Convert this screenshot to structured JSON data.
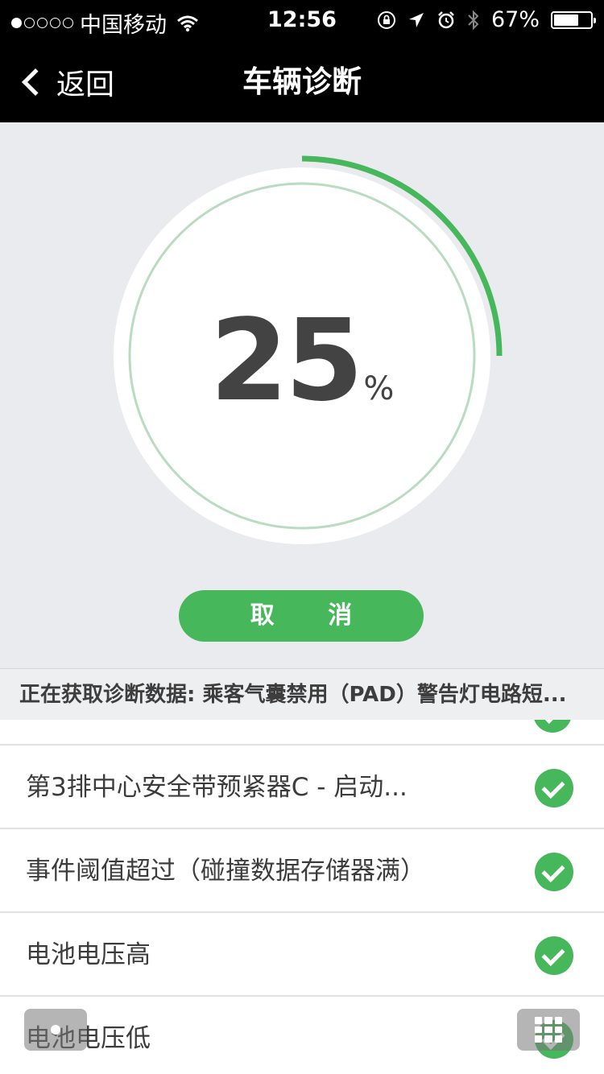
{
  "status_bar": {
    "carrier": "中国移动",
    "time": "12:56",
    "battery_percent": "67%",
    "battery_level": 0.67,
    "signal_bars_filled": 1,
    "icons": [
      "wifi-icon",
      "rotation-lock-icon",
      "location-icon",
      "alarm-icon",
      "bluetooth-icon",
      "battery-icon"
    ]
  },
  "nav": {
    "back_label": "返回",
    "title": "车辆诊断"
  },
  "progress": {
    "value": "25",
    "unit": "%",
    "fraction": 0.25,
    "colors": {
      "arc": "#47b75c",
      "track": "#b9dcc1",
      "face": "#ffffff"
    }
  },
  "cancel_label": "取 消",
  "status_text": "正在获取诊断数据: 乘客气囊禁用（PAD）警告灯电路短...",
  "items": [
    {
      "label": "第3排中心安全带预紧器C - 启动...",
      "status": "check-icon"
    },
    {
      "label": "事件阈值超过（碰撞数据存储器满）",
      "status": "check-icon"
    },
    {
      "label": "电池电压高",
      "status": "check-icon"
    },
    {
      "label": "电池电压低",
      "status": "check-icon"
    }
  ],
  "colors": {
    "accent": "#47b75c",
    "bar": "#000000",
    "background": "#e9ebee"
  }
}
